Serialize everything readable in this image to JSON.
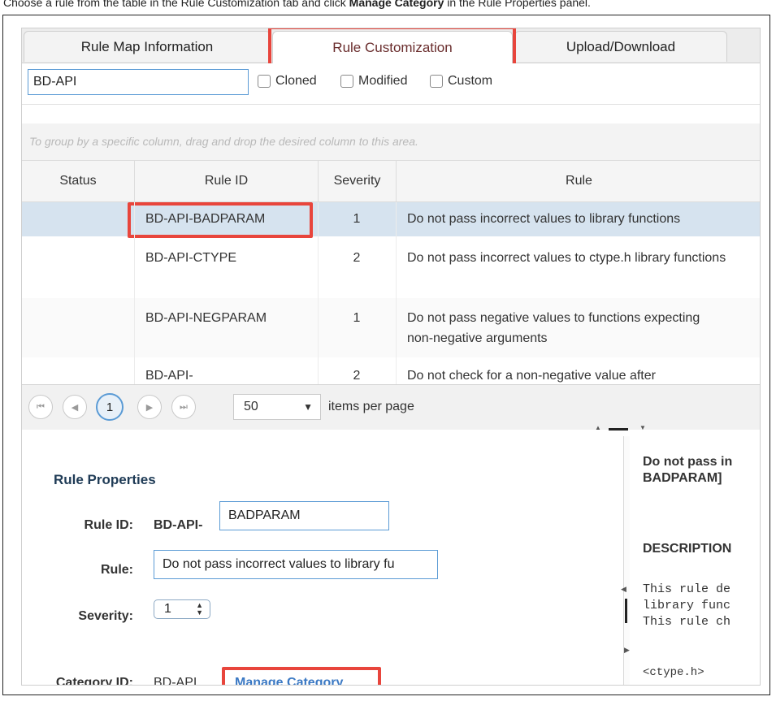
{
  "instruction": {
    "prefix": "Choose a rule from the table in the Rule Customization tab and click ",
    "bold": "Manage Category",
    "suffix": " in the Rule Properties panel."
  },
  "tabs": [
    {
      "label": "Rule Map Information"
    },
    {
      "label": "Rule Customization"
    },
    {
      "label": "Upload/Download"
    }
  ],
  "filter": {
    "search_value": "BD-API",
    "checkboxes": [
      {
        "label": "Cloned"
      },
      {
        "label": "Modified"
      },
      {
        "label": "Custom"
      }
    ]
  },
  "group_hint": "To group by a specific column, drag and drop the desired column to this area.",
  "table": {
    "columns": [
      "Status",
      "Rule ID",
      "Severity",
      "Rule"
    ],
    "rows": [
      {
        "status": "",
        "rule_id": "BD-API-BADPARAM",
        "severity": "1",
        "rule": "Do not pass incorrect values to library functions"
      },
      {
        "status": "",
        "rule_id": "BD-API-CTYPE",
        "severity": "2",
        "rule": "Do not pass incorrect values to ctype.h library functions"
      },
      {
        "status": "",
        "rule_id": "BD-API-NEGPARAM",
        "severity": "1",
        "rule": "Do not pass negative values to functions expecting non-negative arguments"
      },
      {
        "status": "",
        "rule_id": "BD-API-",
        "severity": "2",
        "rule": "Do not check for a non-negative value after"
      }
    ]
  },
  "pager": {
    "current_page": "1",
    "page_size": "50",
    "items_per_page_label": "items per page"
  },
  "properties": {
    "title": "Rule Properties",
    "rule_id_label": "Rule ID:",
    "rule_id_prefix": "BD-API-",
    "rule_id_value": "BADPARAM",
    "rule_label": "Rule:",
    "rule_value": "Do not pass incorrect values to library fu",
    "severity_label": "Severity:",
    "severity_value": "1",
    "category_label": "Category ID:",
    "category_value": "BD-API",
    "manage_label": "Manage Category"
  },
  "doc": {
    "title_line1": "Do not pass in",
    "title_line2": "BADPARAM]",
    "section": "DESCRIPTION",
    "lines": [
      "This rule de",
      "library func",
      "This rule ch"
    ],
    "code": "<ctype.h>"
  },
  "colors": {
    "highlight": "#e8453c",
    "accent": "#5b9bd5",
    "link": "#3b79c4",
    "selected_row": "#d6e3ef"
  }
}
